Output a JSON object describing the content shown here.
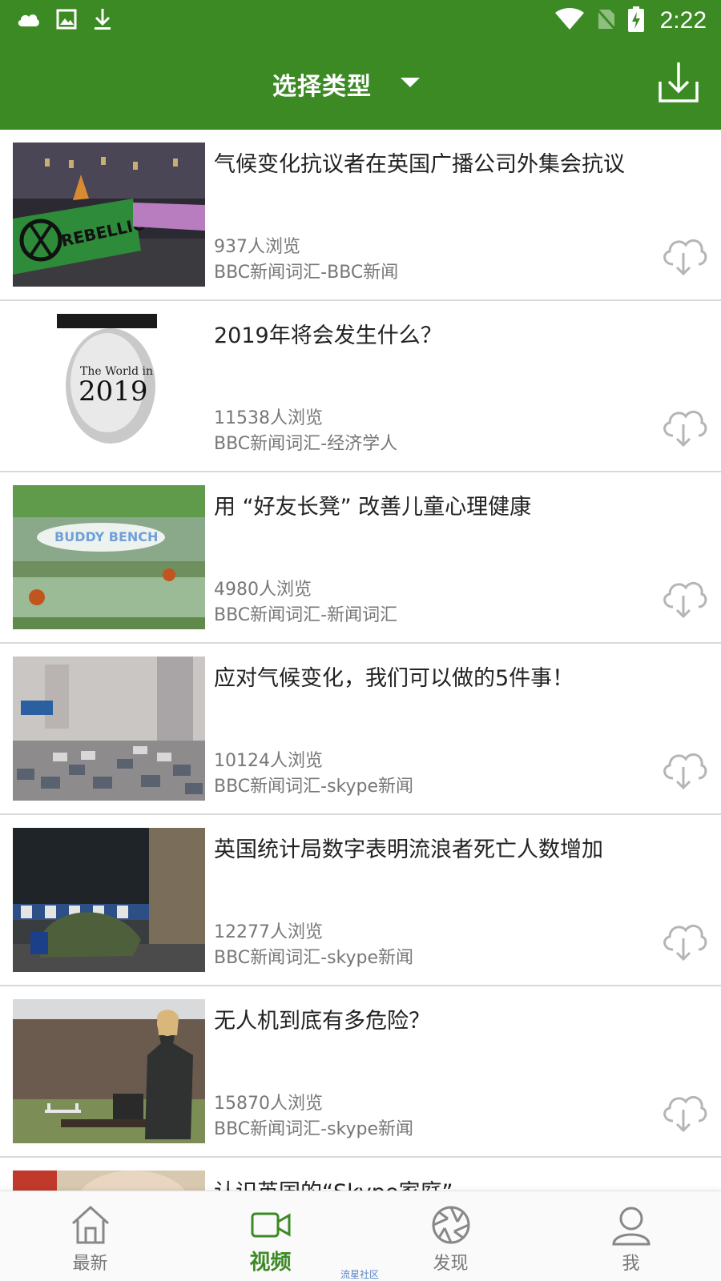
{
  "status_bar": {
    "time": "2:22",
    "icons": [
      "cloud-icon",
      "image-icon",
      "download-arrow-icon",
      "wifi-icon",
      "no-sim-icon",
      "battery-charging-icon"
    ]
  },
  "header": {
    "title": "选择类型",
    "dropdown_icon": "caret-down-icon",
    "action_icon": "download-icon"
  },
  "colors": {
    "primary": "#3c8a23",
    "text_primary": "#222222",
    "text_secondary": "#777777",
    "icon_gray": "#b5b5b5"
  },
  "items": [
    {
      "title": "气候变化抗议者在英国广播公司外集会抗议",
      "views": "937人浏览",
      "source": "BBC新闻词汇-BBC新闻",
      "thumb_text": "REBELLION"
    },
    {
      "title": "2019年将会发生什么？",
      "views": "11538人浏览",
      "source": "BBC新闻词汇-经济学人",
      "thumb_text": "The World in",
      "thumb_text_2": "2019"
    },
    {
      "title": "用 “好友长凳” 改善儿童心理健康",
      "views": "4980人浏览",
      "source": "BBC新闻词汇-新闻词汇",
      "thumb_text": "BUDDY BENCH"
    },
    {
      "title": "应对气候变化，我们可以做的5件事！",
      "views": "10124人浏览",
      "source": "BBC新闻词汇-skype新闻"
    },
    {
      "title": "英国统计局数字表明流浪者死亡人数增加",
      "views": "12277人浏览",
      "source": "BBC新闻词汇-skype新闻"
    },
    {
      "title": "无人机到底有多危险？",
      "views": "15870人浏览",
      "source": "BBC新闻词汇-skype新闻"
    },
    {
      "title": "认识英国的“Skype家庭”",
      "views": "",
      "source": ""
    }
  ],
  "nav": {
    "tabs": [
      {
        "label": "最新",
        "icon": "home-icon",
        "active": false
      },
      {
        "label": "视频",
        "icon": "video-camera-icon",
        "active": true
      },
      {
        "label": "发现",
        "icon": "aperture-icon",
        "active": false
      },
      {
        "label": "我",
        "icon": "user-icon",
        "active": false
      }
    ]
  },
  "watermark": "流星社区"
}
